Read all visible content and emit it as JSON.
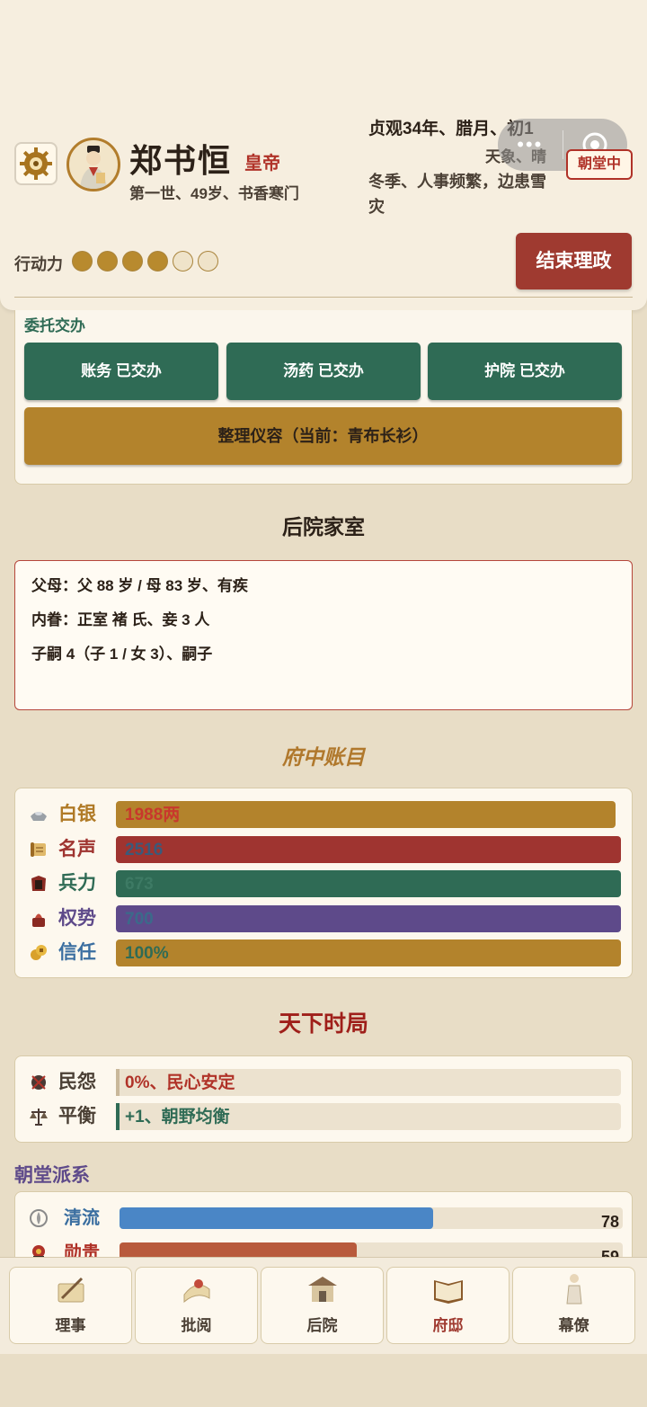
{
  "header": {
    "name": "郑书恒",
    "rank": "皇帝",
    "subinfo": "第一世、49岁、书香寒门",
    "date": "贞观34年、腊月、初1",
    "weather": "天象、晴",
    "season_note": "冬季、人事频繁，边患雪灾",
    "court_badge": "朝堂中",
    "action_label": "行动力",
    "action_points": {
      "filled": 4,
      "total": 6
    },
    "end_button": "结束理政"
  },
  "delegation": {
    "title": "委托交办",
    "buttons": [
      "账务 已交办",
      "汤药 已交办",
      "护院 已交办"
    ],
    "outfit_button": "整理仪容（当前：青布长衫）"
  },
  "family": {
    "title": "后院家室",
    "lines": [
      "父母：父 88 岁 / 母 83 岁、有疾",
      "内眷：正室 褚 氏、妾 3 人",
      "子嗣 4（子 1 / 女 3）、嗣子"
    ]
  },
  "accounts": {
    "title": "府中账目",
    "rows": [
      {
        "label": "白银",
        "value": "1988两",
        "fill": 0.99,
        "bar_color": "#b3832c",
        "label_color": "#b07a26",
        "value_color": "#c8382c",
        "icon": "silver-ingot-icon"
      },
      {
        "label": "名声",
        "value": "2516",
        "fill": 1.0,
        "bar_color": "#9f3430",
        "label_color": "#9f3430",
        "value_color": "#3a5a7a",
        "icon": "scroll-icon"
      },
      {
        "label": "兵力",
        "value": "673",
        "fill": 1.0,
        "bar_color": "#2f6b55",
        "label_color": "#2f6b55",
        "value_color": "#3d7a64",
        "icon": "armor-icon"
      },
      {
        "label": "权势",
        "value": "700",
        "fill": 1.0,
        "bar_color": "#5e4a8a",
        "label_color": "#5e4a8a",
        "value_color": "#3b6a8a",
        "icon": "seal-icon"
      },
      {
        "label": "信任",
        "value": "100%",
        "fill": 1.0,
        "bar_color": "#b3832c",
        "label_color": "#3a6ea0",
        "value_color": "#2f6b55",
        "icon": "coins-icon"
      }
    ]
  },
  "world": {
    "title": "天下时局",
    "rows": [
      {
        "label": "民怨",
        "value": "0%、民心安定",
        "mark_color": "#c9b89a",
        "value_color": "#b03228",
        "icon": "unrest-icon"
      },
      {
        "label": "平衡",
        "value": "+1、朝野均衡",
        "mark_color": "#2f6b55",
        "value_color": "#2f6b55",
        "icon": "scales-icon"
      }
    ]
  },
  "factions": {
    "title": "朝堂派系",
    "rows": [
      {
        "label": "清流",
        "value": "78",
        "fill": 0.78,
        "color": "#4a86c6",
        "label_color": "#3a6ea0",
        "icon": "lotus-icon"
      },
      {
        "label": "勋贵",
        "value": "59",
        "fill": 0.59,
        "color": "#b85a3c",
        "label_color": "#b03228",
        "icon": "noble-icon"
      }
    ]
  },
  "tabs": [
    {
      "label": "理事",
      "icon": "brush-scroll-icon",
      "active": false
    },
    {
      "label": "批阅",
      "icon": "memorial-icon",
      "active": false
    },
    {
      "label": "后院",
      "icon": "courtyard-icon",
      "active": false
    },
    {
      "label": "府邸",
      "icon": "book-icon",
      "active": true
    },
    {
      "label": "幕僚",
      "icon": "advisor-icon",
      "active": false
    }
  ]
}
